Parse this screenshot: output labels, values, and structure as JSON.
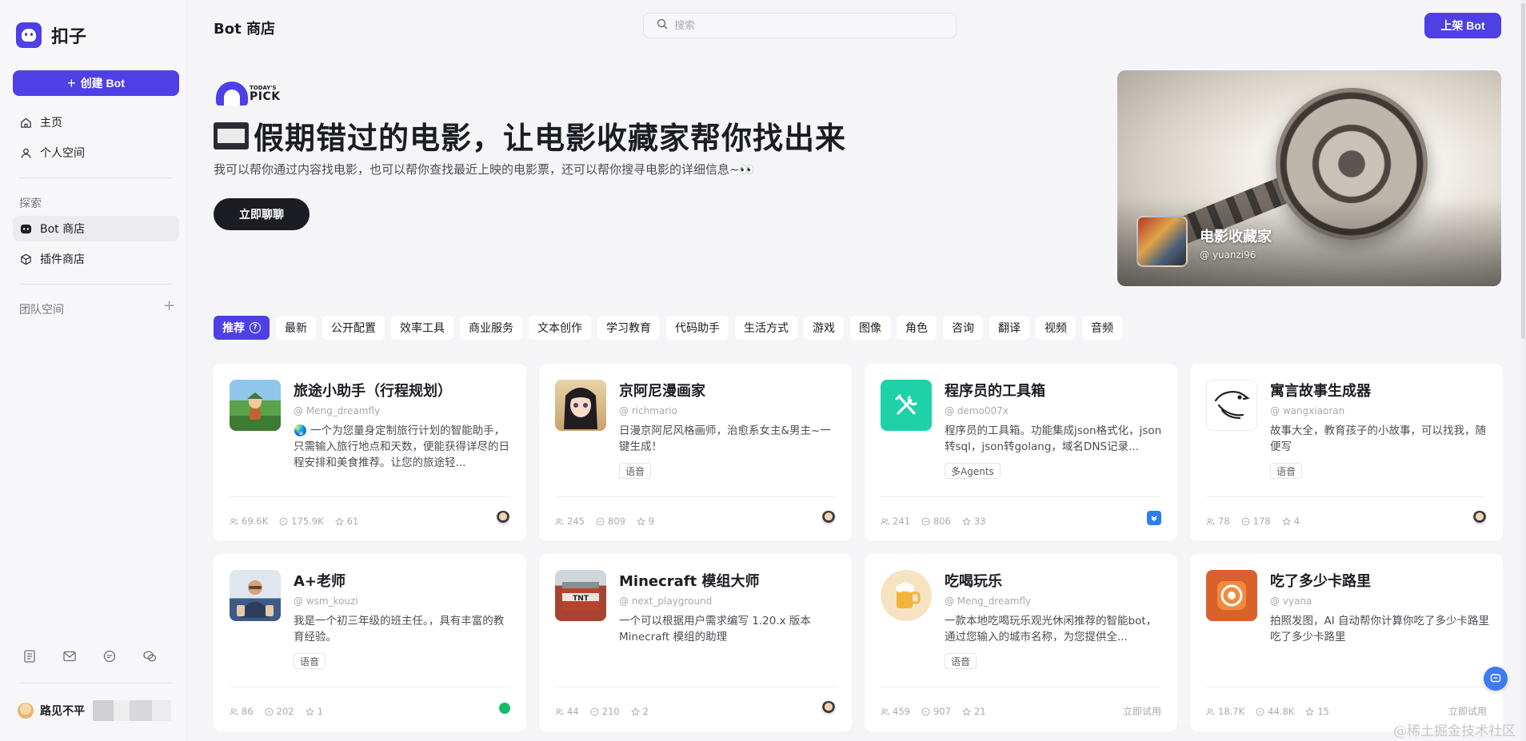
{
  "sidebar": {
    "logo_text": "扣子",
    "create_label": "创建 Bot",
    "nav": [
      {
        "label": "主页",
        "icon": "home-icon"
      },
      {
        "label": "个人空间",
        "icon": "user-icon"
      }
    ],
    "explore_label": "探索",
    "explore": [
      {
        "label": "Bot 商店",
        "icon": "bot-icon"
      },
      {
        "label": "插件商店",
        "icon": "cube-icon"
      }
    ],
    "team_label": "团队空间",
    "user_name": "路见不平"
  },
  "header": {
    "title": "Bot 商店",
    "search_placeholder": "搜索",
    "publish_label": "上架 Bot"
  },
  "hero": {
    "badge_small": "TODAY'S",
    "badge_big": "PICK",
    "title": "假期错过的电影，让电影收藏家帮你找出来",
    "description": "我可以帮你通过内容找电影，也可以帮你查找最近上映的电影票，还可以帮你搜寻电影的详细信息~👀",
    "button": "立即聊聊",
    "bot_name": "电影收藏家",
    "bot_author": "@ yuanzi96"
  },
  "tabs": [
    "推荐",
    "最新",
    "公开配置",
    "效率工具",
    "商业服务",
    "文本创作",
    "学习教育",
    "代码助手",
    "生活方式",
    "游戏",
    "图像",
    "角色",
    "咨询",
    "翻译",
    "视频",
    "音频"
  ],
  "cards": [
    {
      "name": "旅途小助手（行程规划）",
      "author": "@ Meng_dreamfly",
      "desc": "🌏 一个为您量身定制旅行计划的智能助手，只需输入旅行地点和天数，便能获得详尽的日程安排和美食推荐。让您的旅途轻...",
      "tag": "",
      "users": "69.6K",
      "chats": "175.9K",
      "stars": "61",
      "corner": "avatar"
    },
    {
      "name": "京阿尼漫画家",
      "author": "@ richmario",
      "desc": "日漫京阿尼风格画师，治愈系女主&男主~一键生成！",
      "tag": "语音",
      "users": "245",
      "chats": "809",
      "stars": "9",
      "corner": "avatar"
    },
    {
      "name": "程序员的工具箱",
      "author": "@ demo007x",
      "desc": "程序员的工具箱。功能集成json格式化，json转sql，json转golang，域名DNS记录...",
      "tag": "多Agents",
      "users": "241",
      "chats": "806",
      "stars": "33",
      "corner": "blue"
    },
    {
      "name": "寓言故事生成器",
      "author": "@ wangxiaoran",
      "desc": "故事大全，教育孩子的小故事，可以找我，随便写",
      "tag": "语音",
      "users": "78",
      "chats": "178",
      "stars": "4",
      "corner": "avatar"
    },
    {
      "name": "A+老师",
      "author": "@ wsm_kouzi",
      "desc": "我是一个初三年级的班主任。，具有丰富的教育经验。",
      "tag": "语音",
      "users": "86",
      "chats": "202",
      "stars": "1",
      "corner": "green"
    },
    {
      "name": "Minecraft 模组大师",
      "author": "@ next_playground",
      "desc": "一个可以根据用户需求编写 1.20.x 版本 Minecraft 模组的助理",
      "tag": "",
      "users": "44",
      "chats": "210",
      "stars": "2",
      "corner": "avatar"
    },
    {
      "name": "吃喝玩乐",
      "author": "@ Meng_dreamfly",
      "desc": "一款本地吃喝玩乐观光休闲推荐的智能bot，通过您输入的城市名称，为您提供全...",
      "tag": "语音",
      "users": "459",
      "chats": "907",
      "stars": "21",
      "corner": "try"
    },
    {
      "name": "吃了多少卡路里",
      "author": "@ vyana",
      "desc": "拍照发图，AI 自动帮你计算你吃了多少卡路里 吃了多少卡路里",
      "tag": "",
      "users": "18.7K",
      "chats": "44.8K",
      "stars": "15",
      "corner": "try"
    }
  ],
  "try_label": "立即试用",
  "watermark": "@稀土掘金技术社区",
  "colors": {
    "accent": "#4e40e5",
    "background": "#f5f5f8"
  }
}
